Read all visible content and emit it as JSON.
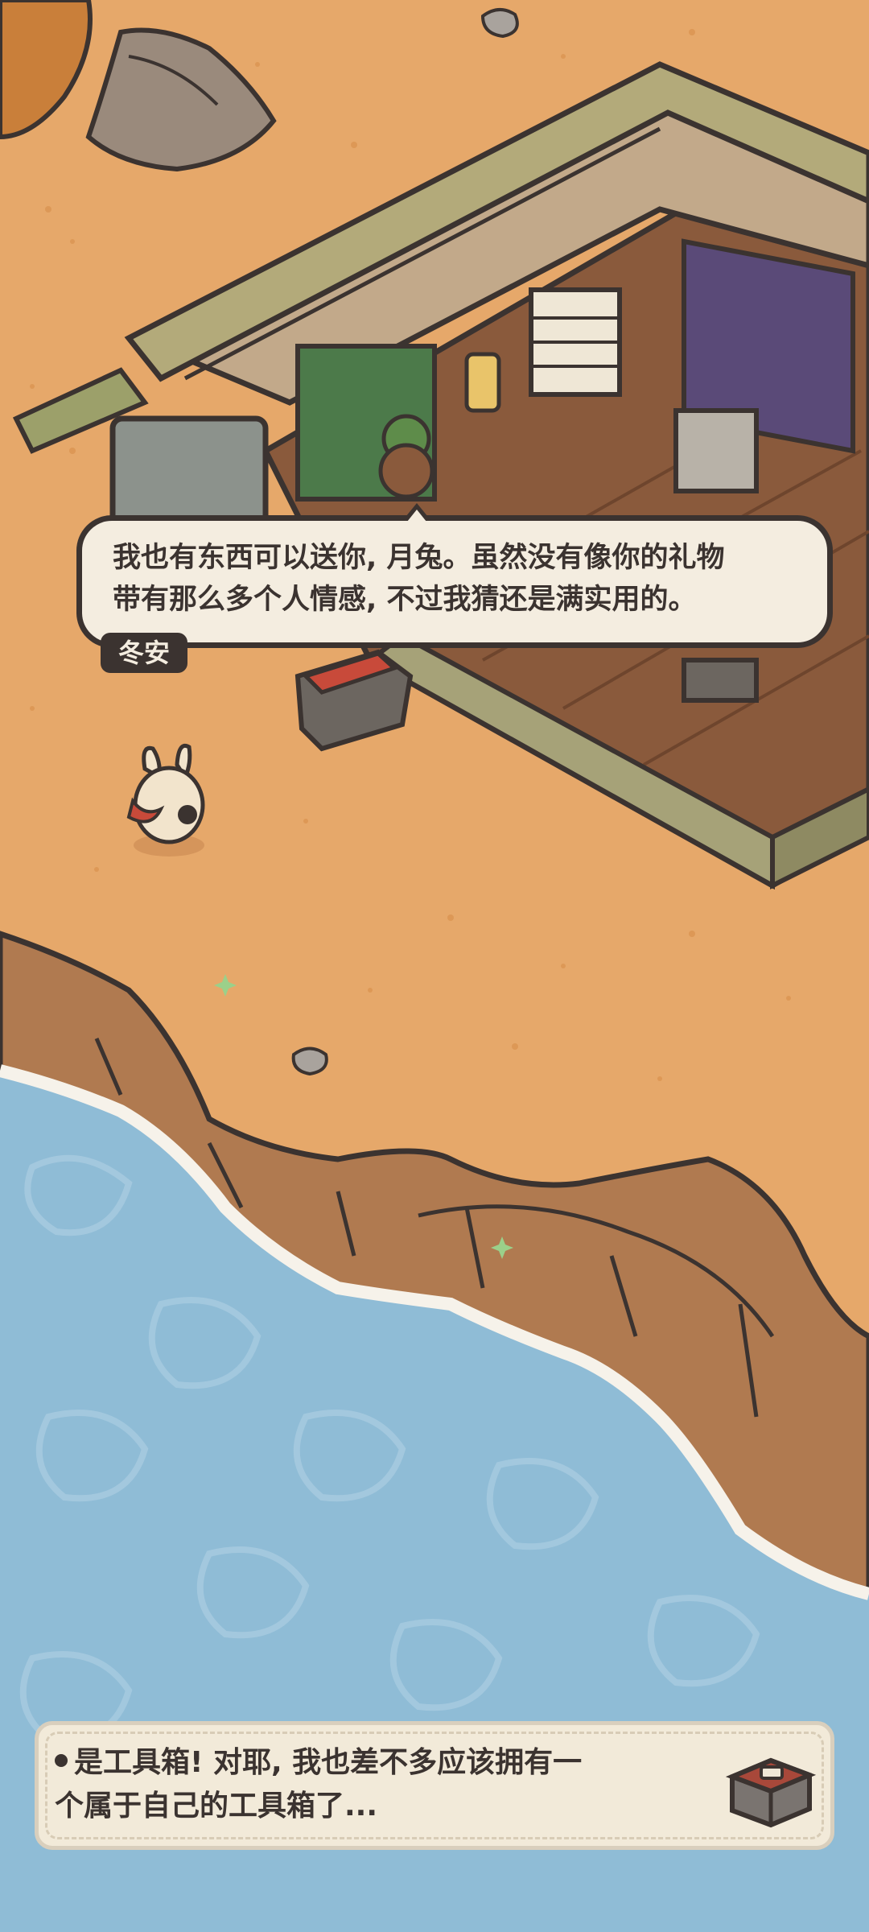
{
  "dialog": {
    "line1": "我也有东西可以送你, 月兔。虽然没有像你的礼物",
    "line2": "带有那么多个人情感, 不过我猜还是满实用的。",
    "speaker": "冬安"
  },
  "notice": {
    "line1": "是工具箱! 对耶, 我也差不多应该拥有一",
    "line2": "个属于自己的工具箱了...",
    "icon": "toolbox-icon"
  },
  "colors": {
    "sand": "#e6a86a",
    "water": "#8fbcd6",
    "cliff": "#b07a50",
    "dialog_bg": "#f4ede0",
    "outline": "#3b3330"
  }
}
